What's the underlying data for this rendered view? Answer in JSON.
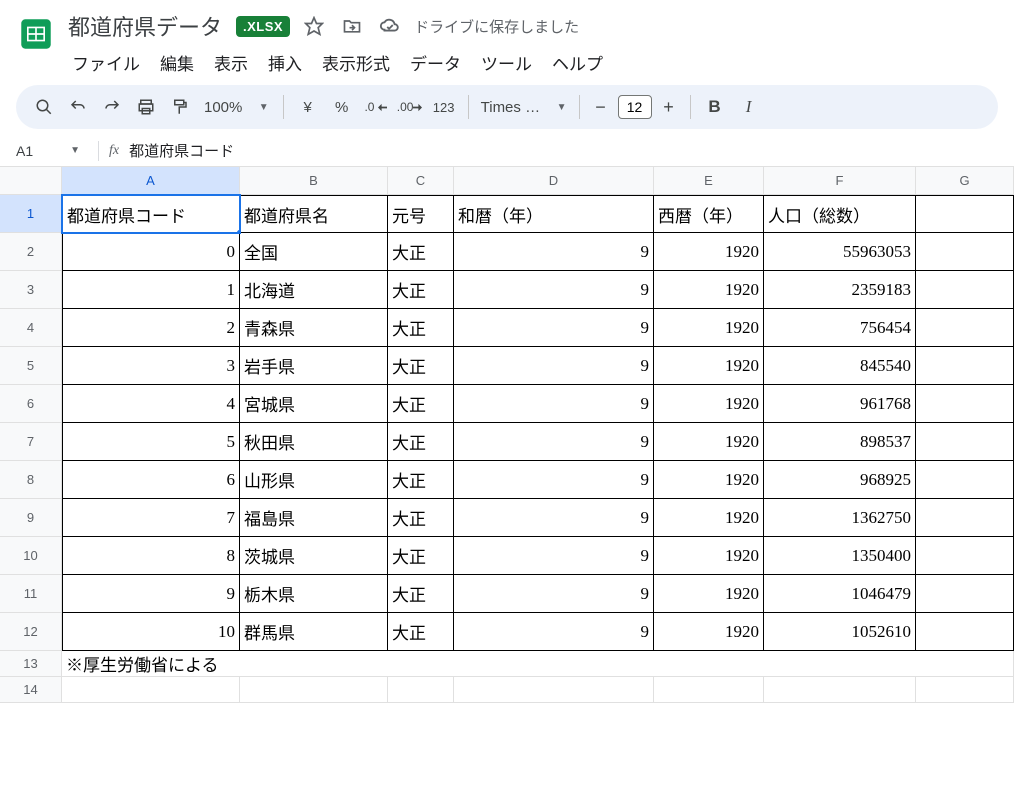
{
  "header": {
    "doc_title": "都道府県データ",
    "badge": ".XLSX",
    "save_msg": "ドライブに保存しました"
  },
  "menus": [
    "ファイル",
    "編集",
    "表示",
    "挿入",
    "表示形式",
    "データ",
    "ツール",
    "ヘルプ"
  ],
  "toolbar": {
    "zoom": "100%",
    "currency": "¥",
    "percent": "%",
    "dec_dec": ".0",
    "inc_dec": ".00",
    "numfmt": "123",
    "font": "Times …",
    "fontsize": "12",
    "bold": "B"
  },
  "namebox": {
    "cell": "A1",
    "fx": "fx",
    "formula": "都道府県コード"
  },
  "cols": [
    "A",
    "B",
    "C",
    "D",
    "E",
    "F",
    "G"
  ],
  "rows": [
    "1",
    "2",
    "3",
    "4",
    "5",
    "6",
    "7",
    "8",
    "9",
    "10",
    "11",
    "12",
    "13",
    "14"
  ],
  "headerRow": [
    "都道府県コード",
    "都道府県名",
    "元号",
    "和暦（年）",
    "西暦（年）",
    "人口（総数）"
  ],
  "data": [
    [
      "0",
      "全国",
      "大正",
      "9",
      "1920",
      "55963053"
    ],
    [
      "1",
      "北海道",
      "大正",
      "9",
      "1920",
      "2359183"
    ],
    [
      "2",
      "青森県",
      "大正",
      "9",
      "1920",
      "756454"
    ],
    [
      "3",
      "岩手県",
      "大正",
      "9",
      "1920",
      "845540"
    ],
    [
      "4",
      "宮城県",
      "大正",
      "9",
      "1920",
      "961768"
    ],
    [
      "5",
      "秋田県",
      "大正",
      "9",
      "1920",
      "898537"
    ],
    [
      "6",
      "山形県",
      "大正",
      "9",
      "1920",
      "968925"
    ],
    [
      "7",
      "福島県",
      "大正",
      "9",
      "1920",
      "1362750"
    ],
    [
      "8",
      "茨城県",
      "大正",
      "9",
      "1920",
      "1350400"
    ],
    [
      "9",
      "栃木県",
      "大正",
      "9",
      "1920",
      "1046479"
    ],
    [
      "10",
      "群馬県",
      "大正",
      "9",
      "1920",
      "1052610"
    ]
  ],
  "note": "※厚生労働省による"
}
